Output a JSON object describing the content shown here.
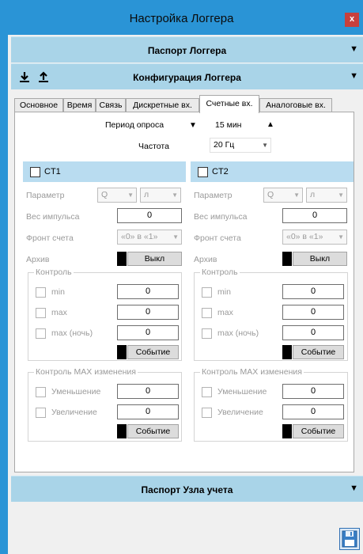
{
  "window": {
    "title": "Настройка Логгера",
    "close_label": "x"
  },
  "sections": {
    "passport_logger": "Паспорт Логгера",
    "config_logger": "Конфигурация Логгера",
    "passport_node": "Паспорт Узла учета",
    "collapse_arrow": "▼"
  },
  "icons": {
    "download": "↓",
    "upload": "↑"
  },
  "tabs": [
    {
      "label": "Основное"
    },
    {
      "label": "Время"
    },
    {
      "label": "Связь"
    },
    {
      "label": "Дискретные вх."
    },
    {
      "label": "Счетные вх.",
      "active": true
    },
    {
      "label": "Аналоговые вх."
    }
  ],
  "poll": {
    "label": "Период опроса",
    "value": "15 мин",
    "down": "▼",
    "up": "▲"
  },
  "frequency": {
    "label": "Частота",
    "value": "20 Гц"
  },
  "ct1": {
    "title": "CT1",
    "param_label": "Параметр",
    "param_q": "Q",
    "param_unit": "л",
    "weight_label": "Вес импульса",
    "weight_value": "0",
    "front_label": "Фронт счета",
    "front_value": "«0» в «1»",
    "archive_label": "Архив",
    "archive_value": "Выкл",
    "control_title": "Контроль",
    "min_label": "min",
    "min_value": "0",
    "max_label": "max",
    "max_value": "0",
    "maxnight_label": "max (ночь)",
    "maxnight_value": "0",
    "event_label": "Событие",
    "change_title": "Контроль MAX изменения",
    "decrease_label": "Уменьшение",
    "decrease_value": "0",
    "increase_label": "Увеличение",
    "increase_value": "0",
    "event2_label": "Событие"
  },
  "ct2": {
    "title": "CT2",
    "param_label": "Параметр",
    "param_q": "Q",
    "param_unit": "л",
    "weight_label": "Вес импульса",
    "weight_value": "0",
    "front_label": "Фронт счета",
    "front_value": "«0» в «1»",
    "archive_label": "Архив",
    "archive_value": "Выкл",
    "control_title": "Контроль",
    "min_label": "min",
    "min_value": "0",
    "max_label": "max",
    "max_value": "0",
    "maxnight_label": "max (ночь)",
    "maxnight_value": "0",
    "event_label": "Событие",
    "change_title": "Контроль MAX изменения",
    "decrease_label": "Уменьшение",
    "decrease_value": "0",
    "increase_label": "Увеличение",
    "increase_value": "0",
    "event2_label": "Событие"
  }
}
